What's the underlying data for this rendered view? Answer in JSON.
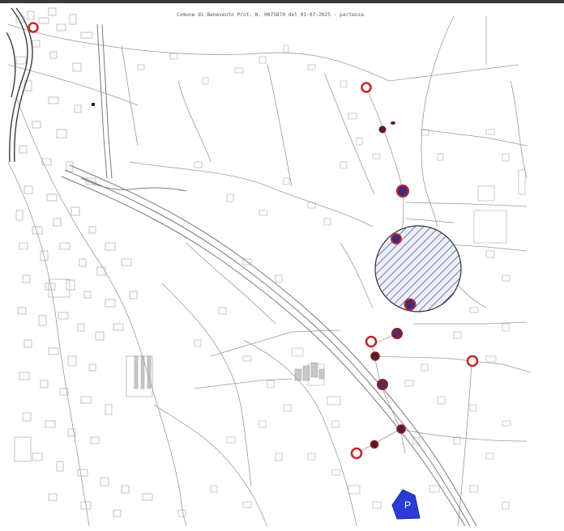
{
  "header": {
    "protocol_stamp": "Comune di Benevento Prot. N. 0075870 del 01-07-2025 - partenza"
  },
  "map": {
    "parking_label": "P",
    "colors": {
      "marker_ring": "#c0282d",
      "marker_fill": "#4a2a6a",
      "marker_dark": "#6a1820",
      "zone_hatch": "#4a5a9a",
      "parking_fill": "#2d3bd6",
      "road": "#9a9a9a",
      "building": "#b5b5b5"
    },
    "icons": [
      "red-ring-marker",
      "filled-marker",
      "hatched-zone",
      "parking-icon"
    ]
  }
}
